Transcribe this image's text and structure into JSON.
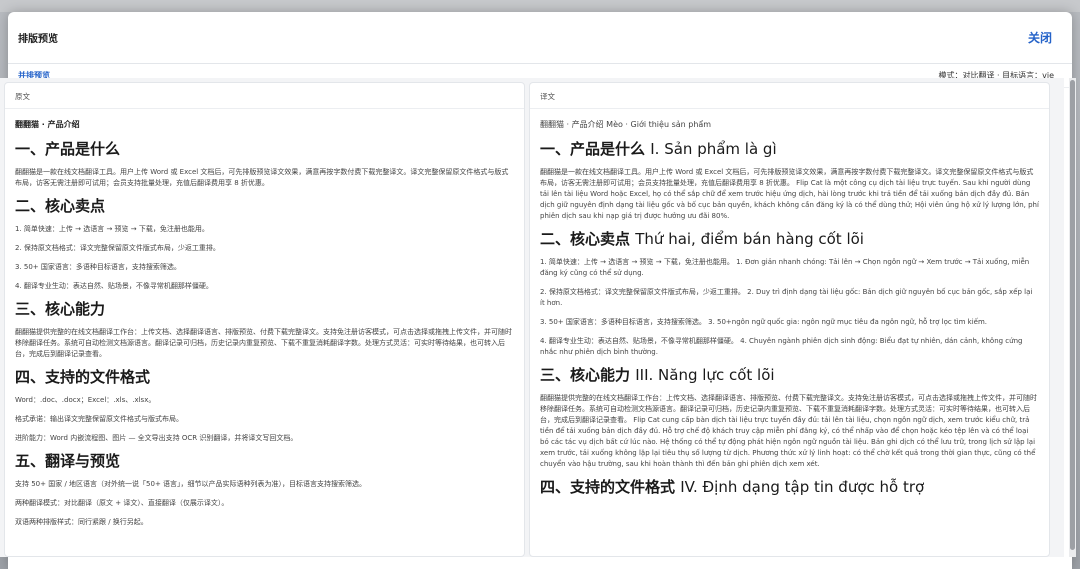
{
  "modal": {
    "title": "排版预览",
    "close_label": "关闭"
  },
  "subbar": {
    "tab_label": "并排预览",
    "mode_text": "模式：对比翻译 · 目标语言：vie"
  },
  "original": {
    "label": "原文",
    "doc_title": "翻翻猫 · 产品介绍",
    "sections": [
      {
        "heading": "一、产品是什么",
        "paras": [
          "翻翻猫是一款在线文档翻译工具。用户上传 Word 或 Excel 文档后，可先排版预览译文效果，满意再按字数付费下载完整译文。译文完整保留原文件格式与版式布局，访客无需注册即可试用；会员支持批量处理，充值后翻译费用享 8 折优惠。"
        ]
      },
      {
        "heading": "二、核心卖点",
        "paras": [
          "1. 简单快速：上传 → 选语言 → 预览 → 下载，免注册也能用。",
          "2. 保持原文档格式：译文完整保留原文件版式布局，少返工重排。",
          "3. 50+ 国家语言：多语种目标语言，支持搜索筛选。",
          "4. 翻译专业生动：表达自然、贴场景，不像寻常机翻那样僵硬。"
        ]
      },
      {
        "heading": "三、核心能力",
        "paras": [
          "翻翻猫提供完整的在线文档翻译工作台：上传文档、选择翻译语言、排版预览、付费下载完整译文。支持免注册访客模式，可点击选择或拖拽上传文件，并可随时移除翻译任务。系统可自动检测文档源语言。翻译记录可归档，历史记录内重复预览、下载不重复消耗翻译字数。处理方式灵活：可实时等待结果，也可转入后台，完成后到翻译记录查看。"
        ]
      },
      {
        "heading": "四、支持的文件格式",
        "paras": [
          "Word：.doc、.docx；Excel：.xls、.xlsx。",
          "格式承诺：输出译文完整保留原文件格式与版式布局。",
          "进阶能力：Word 内嵌流程图、图片 — 全文导出支持 OCR 识别翻译，并将译文写回文档。"
        ]
      },
      {
        "heading": "五、翻译与预览",
        "paras": [
          "支持 50+ 国家 / 地区语言（对外统一说「50+ 语言」，细节以产品实际语种列表为准），目标语言支持搜索筛选。",
          "两种翻译模式：对比翻译（原文 + 译文）、直接翻译（仅展示译文）。",
          "双语两种排版样式：同行紧跟 / 换行另起。"
        ]
      }
    ]
  },
  "translation": {
    "label": "译文",
    "doc_title": "翻翻猫 · 产品介绍 Mèo · Giới thiệu sản phẩm",
    "sections": [
      {
        "heading": "一、产品是什么",
        "heading_tr": "I. Sản phẩm là gì",
        "paras": [
          "翻翻猫是一款在线文档翻译工具。用户上传 Word 或 Excel 文档后，可先排版预览译文效果，满意再按字数付费下载完整译文。译文完整保留原文件格式与版式布局，访客无需注册即可试用；会员支持批量处理，充值后翻译费用享 8 折优惠。 Flip Cat là một công cụ dịch tài liệu trực tuyến. Sau khi người dùng tải lên tài liệu Word hoặc Excel, họ có thể sắp chữ để xem trước hiệu ứng dịch, hài lòng trước khi trả tiền để tải xuống bản dịch đầy đủ. Bản dịch giữ nguyên định dạng tài liệu gốc và bố cục bản quyền, khách không cần đăng ký là có thể dùng thử; Hội viên ủng hộ xử lý lượng lớn, phí phiên dịch sau khi nạp giá trị được hưởng ưu đãi 80%."
        ]
      },
      {
        "heading": "二、核心卖点",
        "heading_tr": "Thứ hai, điểm bán hàng cốt lõi",
        "paras": [
          "1. 简单快速：上传 → 选语言 → 预览 → 下载，免注册也能用。 1. Đơn giản nhanh chóng: Tải lên → Chọn ngôn ngữ → Xem trước → Tải xuống, miễn đăng ký cũng có thể sử dụng.",
          "2. 保持原文档格式：译文完整保留原文件版式布局，少返工重排。 2. Duy trì định dạng tài liệu gốc: Bản dịch giữ nguyên bố cục bản gốc, sắp xếp lại ít hơn.",
          "3. 50+ 国家语言：多语种目标语言，支持搜索筛选。 3. 50+ngôn ngữ quốc gia: ngôn ngữ mục tiêu đa ngôn ngữ, hỗ trợ lọc tìm kiếm.",
          "4. 翻译专业生动：表达自然、贴场景，不像寻常机翻那样僵硬。 4. Chuyên ngành phiên dịch sinh động: Biểu đạt tự nhiên, dán cảnh, không cứng nhắc như phiên dịch bình thường."
        ]
      },
      {
        "heading": "三、核心能力",
        "heading_tr": "III. Năng lực cốt lõi",
        "paras": [
          "翻翻猫提供完整的在线文档翻译工作台：上传文档、选择翻译语言、排版预览、付费下载完整译文。支持免注册访客模式，可点击选择或拖拽上传文件，并可随时移除翻译任务。系统可自动检测文档源语言。翻译记录可归档，历史记录内重复预览、下载不重复消耗翻译字数。处理方式灵活：可实时等待结果，也可转入后台，完成后到翻译记录查看。 Flip Cat cung cấp bàn dịch tài liệu trực tuyến đầy đủ: tải lên tài liệu, chọn ngôn ngữ dịch, xem trước kiểu chữ, trả tiền để tải xuống bản dịch đầy đủ. Hỗ trợ chế độ khách truy cập miễn phí đăng ký, có thể nhấp vào để chọn hoặc kéo tệp lên và có thể loại bỏ các tác vụ dịch bất cứ lúc nào. Hệ thống có thể tự động phát hiện ngôn ngữ nguồn tài liệu. Bản ghi dịch có thể lưu trữ, trong lịch sử lập lại xem trước, tải xuống không lặp lại tiêu thụ số lượng từ dịch. Phương thức xử lý linh hoạt: có thể chờ kết quả trong thời gian thực, cũng có thể chuyển vào hậu trường, sau khi hoàn thành thì đến bản ghi phiên dịch xem xét."
        ]
      },
      {
        "heading": "四、支持的文件格式",
        "heading_tr": "IV. Định dạng tập tin được hỗ trợ",
        "paras": []
      }
    ]
  }
}
